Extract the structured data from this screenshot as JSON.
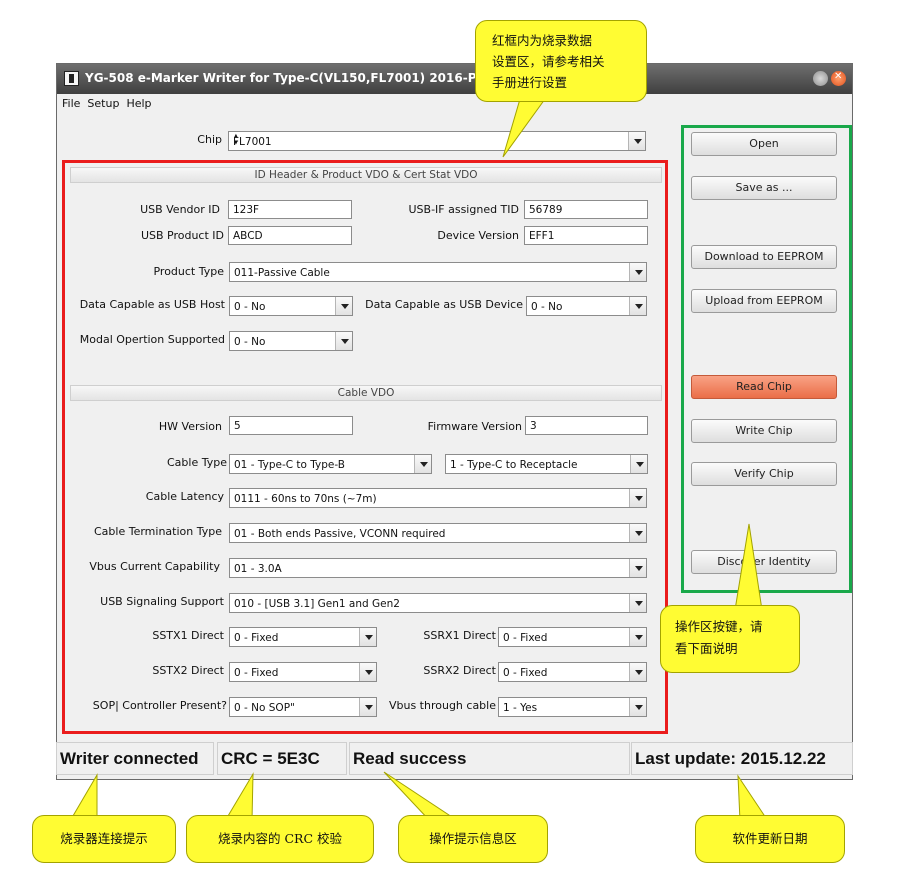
{
  "window": {
    "title": "YG-508 e-Marker Writer for Type-C(VL150,FL7001) 2016-Profess",
    "menu": [
      "File",
      "Setup",
      "Help"
    ]
  },
  "chip": {
    "label": "Chip",
    "value": "FL7001"
  },
  "id_header": {
    "heading": "ID Header & Product VDO & Cert Stat VDO",
    "usb_vendor_id": {
      "label": "USB Vendor ID",
      "value": "123F"
    },
    "usb_if_tid": {
      "label": "USB-IF assigned TID",
      "value": "56789"
    },
    "usb_product_id": {
      "label": "USB Product ID",
      "value": "ABCD"
    },
    "device_version": {
      "label": "Device Version",
      "value": "EFF1"
    },
    "product_type": {
      "label": "Product Type",
      "value": "011-Passive Cable"
    },
    "data_host": {
      "label": "Data Capable as USB Host",
      "value": "0 - No"
    },
    "data_device": {
      "label": "Data Capable as USB Device",
      "value": "0 - No"
    },
    "modal": {
      "label": "Modal Opertion Supported",
      "value": "0 - No"
    }
  },
  "cable_vdo": {
    "heading": "Cable VDO",
    "hw_version": {
      "label": "HW Version",
      "value": "5"
    },
    "fw_version": {
      "label": "Firmware Version",
      "value": "3"
    },
    "cable_type": {
      "label": "Cable Type",
      "value1": "01 - Type-C to Type-B",
      "value2": "1 - Type-C to Receptacle"
    },
    "cable_latency": {
      "label": "Cable Latency",
      "value": "0111 - 60ns to 70ns (~7m)"
    },
    "termination": {
      "label": "Cable Termination Type",
      "value": "01 - Both ends Passive, VCONN required"
    },
    "vbus_current": {
      "label": "Vbus Current Capability",
      "value": "01 - 3.0A"
    },
    "signaling": {
      "label": "USB Signaling Support",
      "value": "010 - [USB 3.1] Gen1 and Gen2"
    },
    "sstx1": {
      "label": "SSTX1 Direct",
      "value": "0 - Fixed"
    },
    "ssrx1": {
      "label": "SSRX1 Direct",
      "value": "0 - Fixed"
    },
    "sstx2": {
      "label": "SSTX2 Direct",
      "value": "0 - Fixed"
    },
    "ssrx2": {
      "label": "SSRX2 Direct",
      "value": "0 - Fixed"
    },
    "sop_controller": {
      "label": "SOP| Controller Present?",
      "value": "0 - No SOP\""
    },
    "vbus_through": {
      "label": "Vbus through cable",
      "value": "1 - Yes"
    }
  },
  "buttons": {
    "open": "Open",
    "save_as": "Save as ...",
    "download": "Download to EEPROM",
    "upload": "Upload from EEPROM",
    "read": "Read Chip",
    "write": "Write Chip",
    "verify": "Verify Chip",
    "discover": "Discover Identity"
  },
  "status": {
    "writer": "Writer connected",
    "crc": "CRC = 5E3C",
    "message": "Read success",
    "last_update": "Last update: 2015.12.22"
  },
  "callouts": {
    "red_area_line1": "红框内为烧录数据",
    "red_area_line2": "设置区，请参考相关",
    "red_area_line3": "手册进行设置",
    "buttons_line1": "操作区按键，请",
    "buttons_line2": "看下面说明",
    "writer_conn": "烧录器连接提示",
    "crc_check": "烧录内容的 CRC 校验",
    "message_area": "操作提示信息区",
    "update_date": "软件更新日期"
  },
  "colors": {
    "red_frame": "#ea1c1c",
    "green_frame": "#19a84a",
    "callout": "#fffc33",
    "read_button": "#ea6e48"
  }
}
